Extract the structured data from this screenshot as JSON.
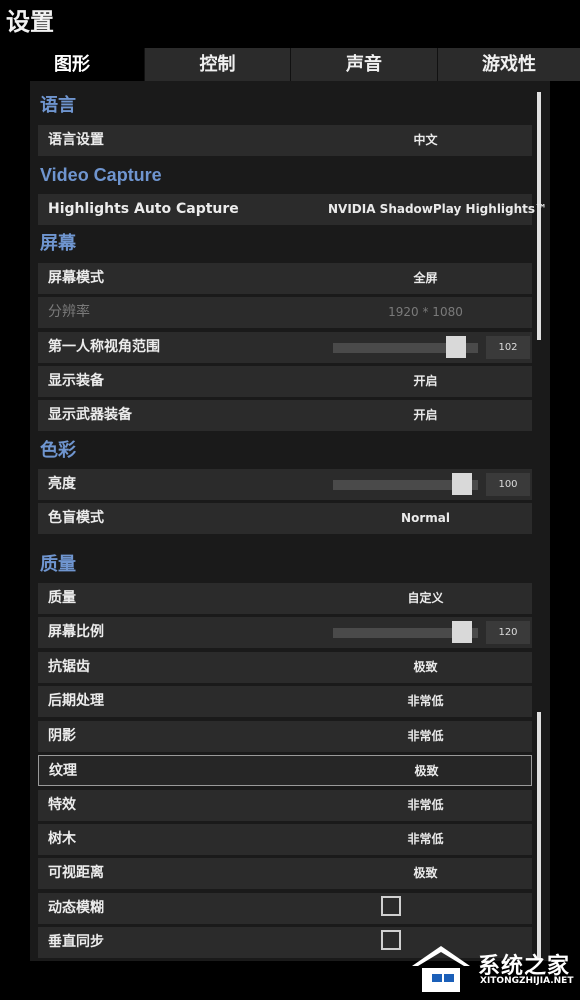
{
  "window": {
    "title": "设置"
  },
  "tabs": [
    {
      "label": "图形",
      "active": true
    },
    {
      "label": "控制"
    },
    {
      "label": "声音"
    },
    {
      "label": "游戏性"
    }
  ],
  "sections": {
    "language": "语言",
    "video_capture": "Video Capture",
    "screen": "屏幕",
    "color": "色彩",
    "quality": "质量"
  },
  "rows": {
    "language_setting": {
      "label": "语言设置",
      "value": "中文"
    },
    "highlights": {
      "label": "Highlights Auto Capture",
      "value": "NVIDIA ShadowPlay Highlights™"
    },
    "screen_mode": {
      "label": "屏幕模式",
      "value": "全屏"
    },
    "resolution": {
      "label": "分辨率",
      "value": "1920 * 1080"
    },
    "fov": {
      "label": "第一人称视角范围",
      "value": "102",
      "level": 0.9
    },
    "show_equipment": {
      "label": "显示装备",
      "value": "开启"
    },
    "show_weapon_equipment": {
      "label": "显示武器装备",
      "value": "开启"
    },
    "brightness": {
      "label": "亮度",
      "value": "100",
      "level": 0.95
    },
    "colorblind": {
      "label": "色盲模式",
      "value": "Normal"
    },
    "quality": {
      "label": "质量",
      "value": "自定义"
    },
    "screen_scale": {
      "label": "屏幕比例",
      "value": "120",
      "level": 0.95
    },
    "antialiasing": {
      "label": "抗锯齿",
      "value": "极致"
    },
    "post_processing": {
      "label": "后期处理",
      "value": "非常低"
    },
    "shadows": {
      "label": "阴影",
      "value": "非常低"
    },
    "textures": {
      "label": "纹理",
      "value": "极致"
    },
    "effects": {
      "label": "特效",
      "value": "非常低"
    },
    "foliage": {
      "label": "树木",
      "value": "非常低"
    },
    "view_distance": {
      "label": "可视距离",
      "value": "极致"
    },
    "motion_blur": {
      "label": "动态模糊",
      "checked": false
    },
    "vsync": {
      "label": "垂直同步",
      "checked": false
    }
  },
  "watermark": {
    "text": "系统之家",
    "url": "XITONGZHIJIA.NET"
  },
  "colors": {
    "section": "#6f95cf",
    "row_bg": "#2b2b2b",
    "tab_bg": "#2b2b2b",
    "background": "#000000"
  }
}
